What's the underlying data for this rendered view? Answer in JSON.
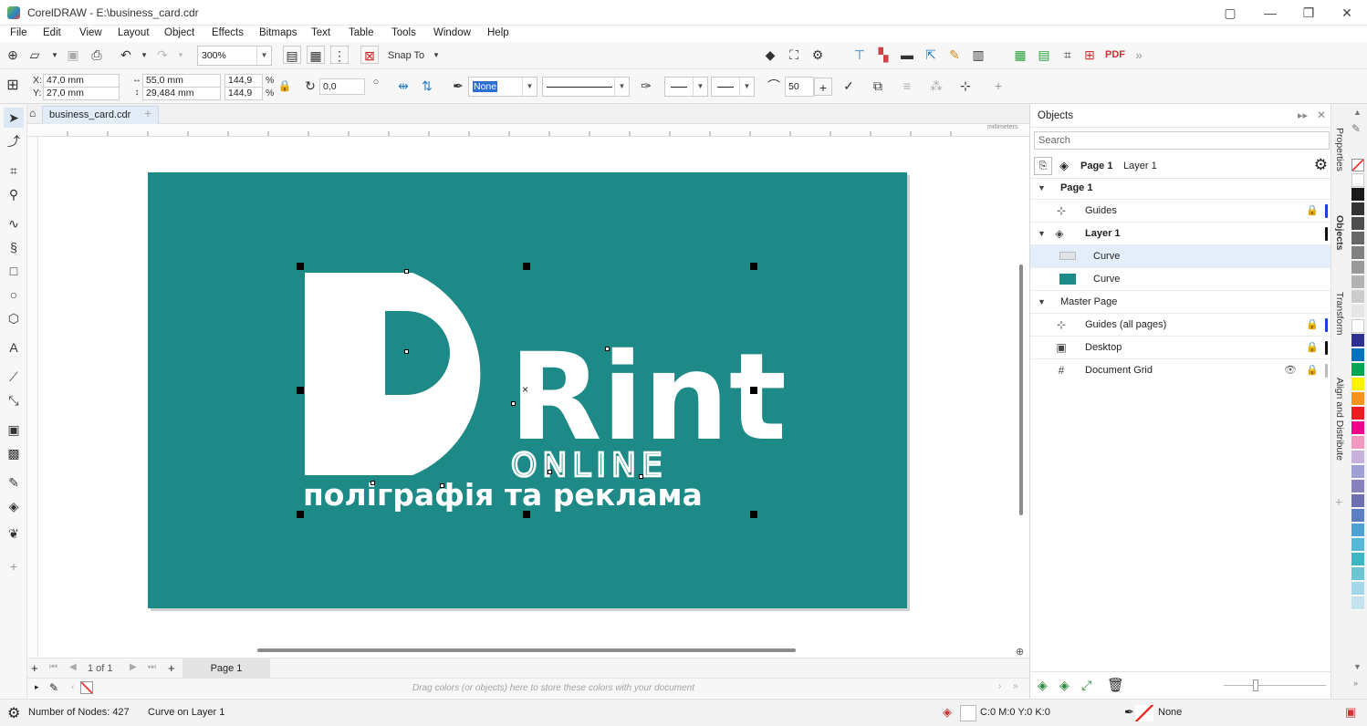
{
  "window": {
    "title": "CorelDRAW - E:\\business_card.cdr",
    "minimize": "—",
    "restore": "❐",
    "close": "✕"
  },
  "menu": [
    "File",
    "Edit",
    "View",
    "Layout",
    "Object",
    "Effects",
    "Bitmaps",
    "Text",
    "Table",
    "Tools",
    "Window",
    "Help"
  ],
  "toolbar": {
    "zoom": "300%",
    "snap_to": "Snap To",
    "pdf": "PDF"
  },
  "propbar": {
    "x_label": "X:",
    "x_value": "47,0 mm",
    "y_label": "Y:",
    "y_value": "27,0 mm",
    "width": "55,0 mm",
    "height": "29,484 mm",
    "scale_w": "144,9",
    "scale_h": "144,9",
    "pct1": "%",
    "pct2": "%",
    "rotation": "0,0",
    "outline": "None",
    "smoothing": "50"
  },
  "document": {
    "tab": "business_card.cdr",
    "card_color": "#1d8a88",
    "logo_word": "Rint",
    "logo_letter": "P",
    "logo_sub": "ONLINE",
    "logo_tagline": "поліграфія та реклама",
    "ruler_unit": "millimeters"
  },
  "pager": {
    "count": "1 of 1",
    "page_tab": "Page 1"
  },
  "palette_hint": "Drag colors (or objects) here to store these colors with your document",
  "status": {
    "nodes": "Number of Nodes: 427",
    "selection": "Curve on Layer 1",
    "fill": "C:0 M:0 Y:0 K:0",
    "outline": "None"
  },
  "objects_panel": {
    "title": "Objects",
    "search_placeholder": "Search",
    "crumb_page": "Page 1",
    "crumb_layer": "Layer 1",
    "rows": [
      {
        "label": "Page 1"
      },
      {
        "label": "Guides"
      },
      {
        "label": "Layer 1"
      },
      {
        "label": "Curve"
      },
      {
        "label": "Curve"
      },
      {
        "label": "Master Page"
      },
      {
        "label": "Guides (all pages)"
      },
      {
        "label": "Desktop"
      },
      {
        "label": "Document Grid"
      }
    ]
  },
  "side_tabs": [
    "Properties",
    "Objects",
    "Transform",
    "Align and Distribute"
  ],
  "palette_colors": [
    "#ffffff",
    "#1a1a1a",
    "#333333",
    "#4d4d4d",
    "#666666",
    "#808080",
    "#999999",
    "#b3b3b3",
    "#cccccc",
    "#e6e6e6",
    "#ffffff",
    "#2e3192",
    "#0071bc",
    "#00a651",
    "#fff200",
    "#f7941d",
    "#ed1c24",
    "#ec008c",
    "#f49ac2",
    "#c7b2de",
    "#a0a0d8",
    "#8781bd",
    "#6d6fb1",
    "#5b7fc2",
    "#4ea1d3",
    "#55b8d9",
    "#3db6c4",
    "#6cc6d1",
    "#a2d6e8",
    "#c5e3ef"
  ]
}
